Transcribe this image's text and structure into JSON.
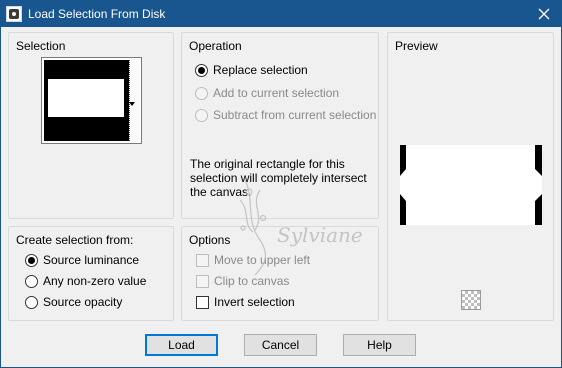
{
  "window": {
    "title": "Load Selection From Disk",
    "close_icon": "close-icon"
  },
  "selection_panel": {
    "title": "Selection"
  },
  "operation_panel": {
    "title": "Operation",
    "options": [
      {
        "label": "Replace selection",
        "checked": true,
        "disabled": false
      },
      {
        "label": "Add to current selection",
        "checked": false,
        "disabled": true
      },
      {
        "label": "Subtract from current selection",
        "checked": false,
        "disabled": true
      }
    ],
    "info": "The original rectangle for this selection will completely intersect the canvas."
  },
  "preview_panel": {
    "title": "Preview"
  },
  "create_panel": {
    "title": "Create selection from:",
    "options": [
      {
        "label": "Source luminance",
        "checked": true
      },
      {
        "label": "Any non-zero value",
        "checked": false
      },
      {
        "label": "Source opacity",
        "checked": false
      }
    ]
  },
  "options_panel": {
    "title": "Options",
    "items": [
      {
        "label": "Move to upper left",
        "checked": false,
        "disabled": true
      },
      {
        "label": "Clip to canvas",
        "checked": false,
        "disabled": true
      },
      {
        "label": "Invert selection",
        "checked": false,
        "disabled": false
      }
    ]
  },
  "buttons": {
    "load": "Load",
    "cancel": "Cancel",
    "help": "Help"
  },
  "watermark_text": "Sylviane",
  "colors": {
    "titlebar": "#19558e",
    "dialog_bg": "#f0f0f0",
    "default_button_border": "#0078d7"
  }
}
